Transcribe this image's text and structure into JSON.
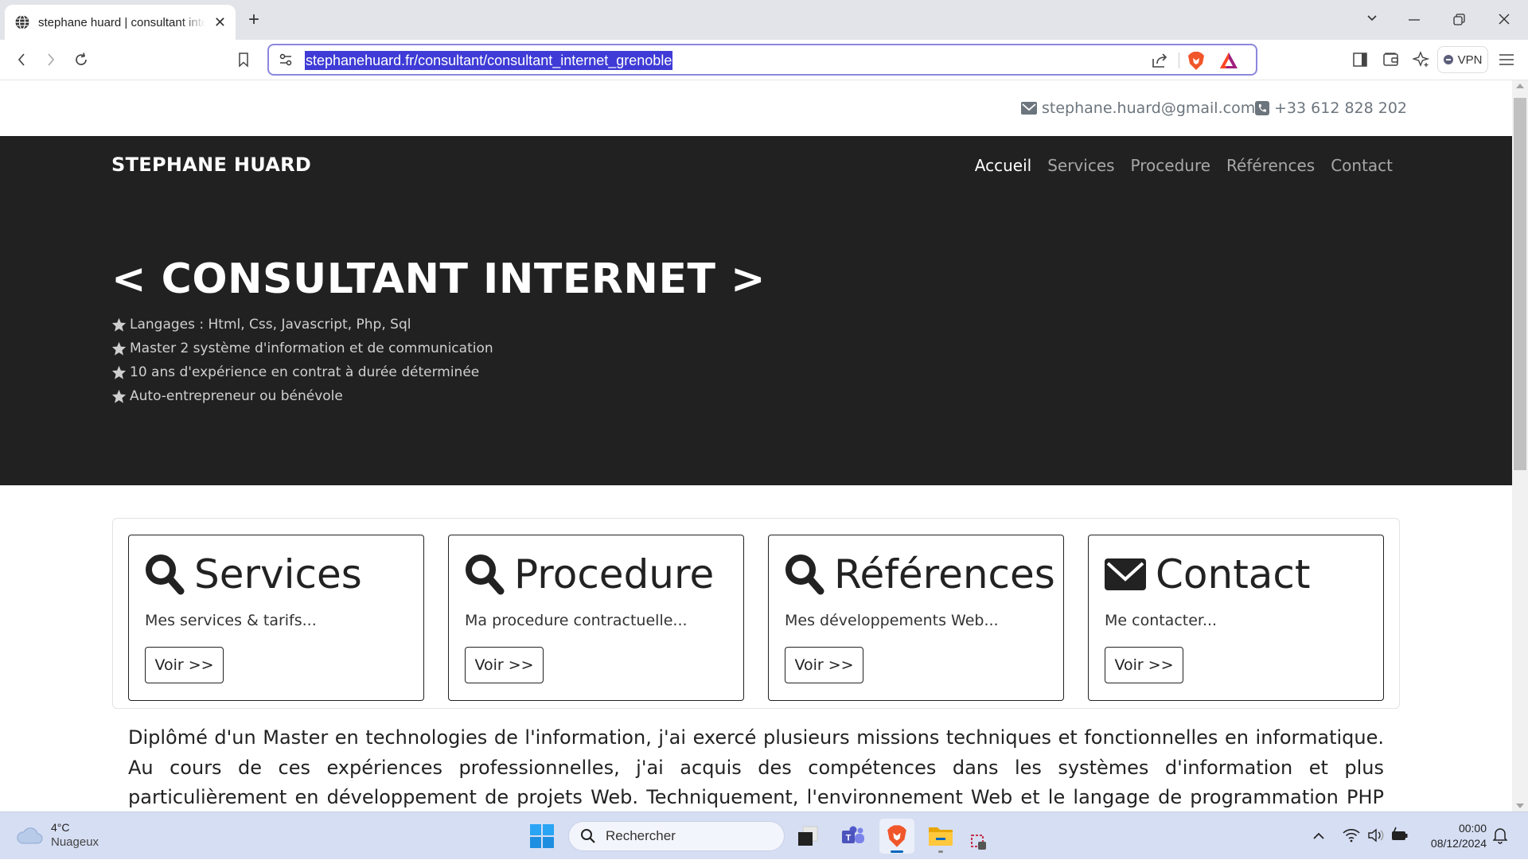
{
  "browser": {
    "tab_title": "stephane huard | consultant internet grenoble",
    "tab_close": "✕",
    "new_tab": "+",
    "url": "stephanehuard.fr/consultant/consultant_internet_grenoble",
    "vpn_label": "VPN",
    "window_controls": {
      "tab_search": "⌄",
      "minimize": "—",
      "restore": "❐",
      "close": "✕"
    }
  },
  "page": {
    "top_contact": {
      "email": "stephane.huard@gmail.com",
      "phone": "+33 612 828 202"
    },
    "brand": "STEPHANE HUARD",
    "nav": [
      {
        "label": "Accueil",
        "active": true
      },
      {
        "label": "Services",
        "active": false
      },
      {
        "label": "Procedure",
        "active": false
      },
      {
        "label": "Références",
        "active": false
      },
      {
        "label": "Contact",
        "active": false
      }
    ],
    "hero": {
      "title": "< CONSULTANT INTERNET >",
      "bullets": [
        "Langages : Html, Css, Javascript, Php, Sql",
        "Master 2 système d'information et de communication",
        "10 ans d'expérience en contrat à durée déterminée",
        "Auto-entrepreneur ou bénévole"
      ]
    },
    "cards": [
      {
        "icon": "search-icon",
        "title": "Services",
        "text": "Mes services & tarifs...",
        "button": "Voir >>"
      },
      {
        "icon": "search-icon",
        "title": "Procedure",
        "text": "Ma procedure contractuelle...",
        "button": "Voir >>"
      },
      {
        "icon": "search-icon",
        "title": "Références",
        "text": "Mes développements Web...",
        "button": "Voir >>"
      },
      {
        "icon": "envelope-icon",
        "title": "Contact",
        "text": "Me contacter...",
        "button": "Voir >>"
      }
    ],
    "intro": "Diplômé d'un Master en technologies de l'information, j'ai exercé plusieurs missions techniques et fonctionnelles en informatique. Au cours de ces expériences professionnelles, j'ai acquis des compétences dans les systèmes d'information et plus particulièrement en développement de projets Web. Techniquement, l'environnement Web et le langage de programmation PHP (Hypertext Preprocessor) couplé à un système de"
  },
  "taskbar": {
    "weather": {
      "temp": "4°C",
      "desc": "Nuageux"
    },
    "search_placeholder": "Rechercher",
    "clock": {
      "time": "00:00",
      "date": "08/12/2024"
    }
  },
  "colors": {
    "hero_bg": "#212121",
    "url_highlight": "#3e3bd6",
    "urlbar_border": "#8b87dd",
    "taskbar_bg": "#d6def3"
  }
}
